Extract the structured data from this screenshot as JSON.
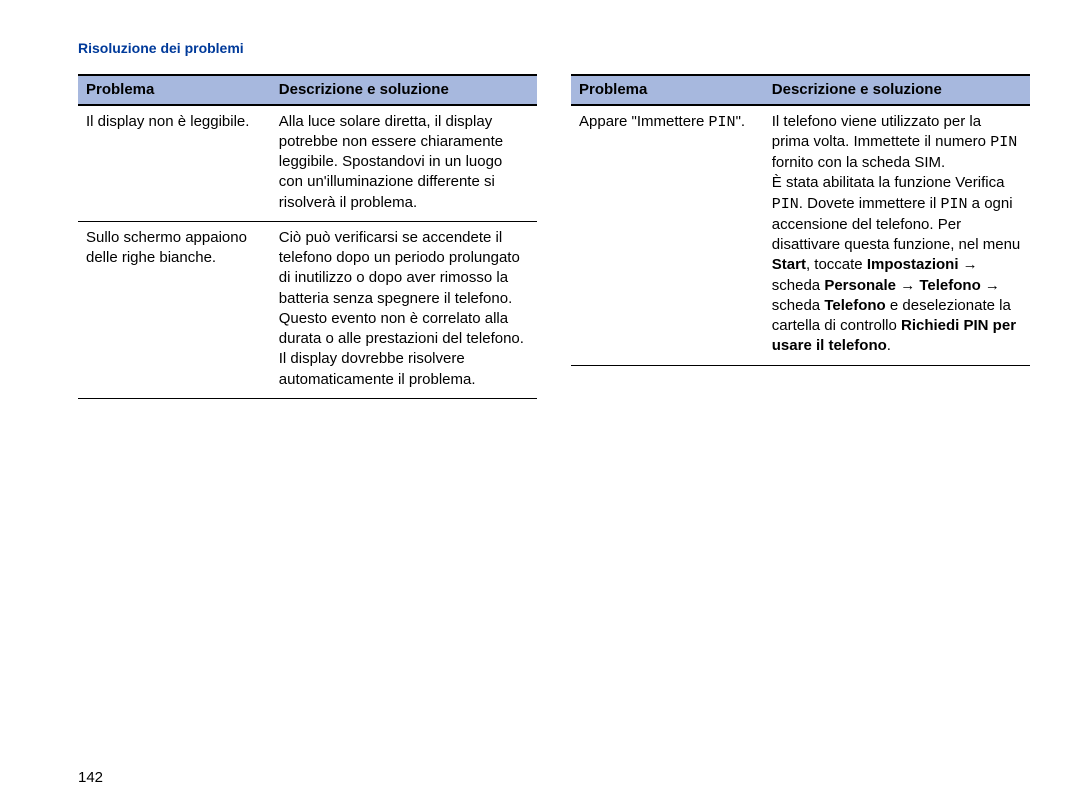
{
  "section_title": "Risoluzione dei problemi",
  "headers": {
    "problema": "Problema",
    "soluzione": "Descrizione e soluzione"
  },
  "left_rows": [
    {
      "problema_text": "Il display non è leggibile.",
      "soluzione_text": "Alla luce solare diretta, il display potrebbe non essere chiaramente leggibile. Spostandovi in un luogo con un'illuminazione differente si risolverà il problema."
    },
    {
      "problema_text": "Sullo schermo appaiono delle righe bianche.",
      "soluzione_text": "Ciò può verificarsi se accendete il telefono dopo un periodo prolungato di inutilizzo o dopo aver rimosso la batteria senza spegnere il telefono. Questo evento non è correlato alla durata o alle prestazioni del telefono. Il display dovrebbe risolvere automaticamente il problema."
    }
  ],
  "right_row": {
    "problema": {
      "pre": "Appare \"Immettere ",
      "mono": "PIN",
      "post": "\"."
    },
    "soluzione": {
      "p1_pre": "Il telefono viene utilizzato per la prima volta. Immettete il numero ",
      "p1_mono": "PIN",
      "p1_post": " fornito con la scheda SIM.",
      "p2_a": "È stata abilitata la funzione Verifica ",
      "p2_mono1": "PIN",
      "p2_b": ". Dovete immettere il ",
      "p2_mono2": "PIN",
      "p2_c": " a ogni accensione del telefono. Per disattivare questa funzione, nel menu ",
      "p2_start": "Start",
      "p2_d": ", toccate ",
      "p2_impost": "Impostazioni",
      "p2_arrow1": " → ",
      "p2_e": "scheda ",
      "p2_personale": "Personale",
      "p2_arrow2": " → ",
      "p2_telefono1": "Telefono",
      "p2_arrow3": " → ",
      "p2_f": "scheda ",
      "p2_telefono2": "Telefono",
      "p2_g": " e deselezionate la cartella di controllo ",
      "p2_richiedi": "Richiedi PIN per usare il telefono",
      "p2_h": "."
    }
  },
  "page_number": "142"
}
